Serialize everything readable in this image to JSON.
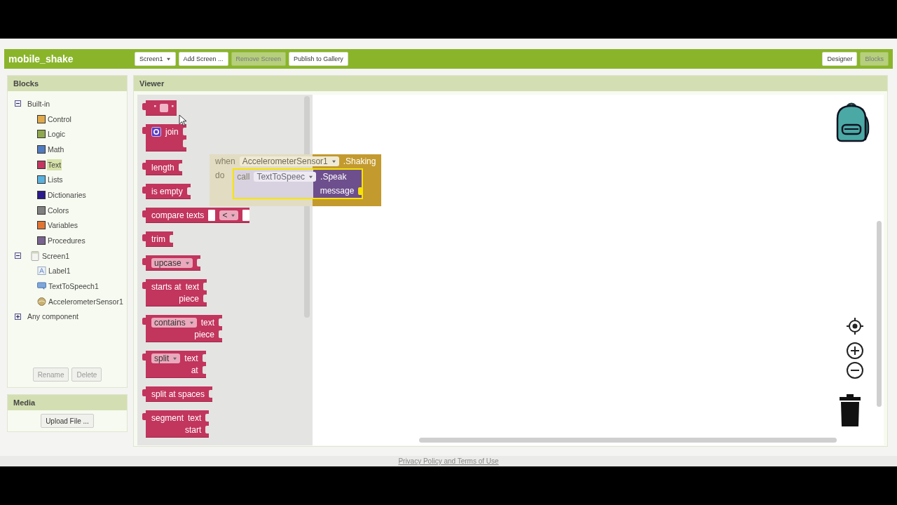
{
  "app": {
    "project_name": "mobile_shake",
    "toolbar_buttons": [
      {
        "label": "Screen1",
        "kind": "dropdown",
        "disabled": false
      },
      {
        "label": "Add Screen ...",
        "kind": "button",
        "disabled": false
      },
      {
        "label": "Remove Screen",
        "kind": "button",
        "disabled": true
      },
      {
        "label": "Publish to Gallery",
        "kind": "button",
        "disabled": false
      }
    ],
    "view_tabs": [
      {
        "label": "Designer",
        "selected": false
      },
      {
        "label": "Blocks",
        "selected": true
      }
    ]
  },
  "blocks_panel": {
    "title": "Blocks",
    "tree": [
      {
        "label": "Built-in",
        "kind": "folder",
        "expanded": true,
        "children": [
          {
            "label": "Control",
            "kind": "category",
            "color": "#e1a94b",
            "selected": false
          },
          {
            "label": "Logic",
            "kind": "category",
            "color": "#8fa84d",
            "selected": false
          },
          {
            "label": "Math",
            "kind": "category",
            "color": "#4f7bc0",
            "selected": false
          },
          {
            "label": "Text",
            "kind": "category",
            "color": "#c4365f",
            "selected": true
          },
          {
            "label": "Lists",
            "kind": "category",
            "color": "#5ab1dd",
            "selected": false
          },
          {
            "label": "Dictionaries",
            "kind": "category",
            "color": "#2a1a8c",
            "selected": false
          },
          {
            "label": "Colors",
            "kind": "category",
            "color": "#808080",
            "selected": false
          },
          {
            "label": "Variables",
            "kind": "category",
            "color": "#e27431",
            "selected": false
          },
          {
            "label": "Procedures",
            "kind": "category",
            "color": "#7a6390",
            "selected": false
          }
        ]
      },
      {
        "label": "Screen1",
        "kind": "screen",
        "expanded": true,
        "children": [
          {
            "label": "Label1",
            "kind": "label",
            "selected": false
          },
          {
            "label": "TextToSpeech1",
            "kind": "speech",
            "selected": false
          },
          {
            "label": "AccelerometerSensor1",
            "kind": "sensor",
            "selected": false
          }
        ]
      },
      {
        "label": "Any component",
        "kind": "folder",
        "expanded": false
      }
    ],
    "buttons": [
      {
        "label": "Rename",
        "disabled": true
      },
      {
        "label": "Delete",
        "disabled": true
      }
    ]
  },
  "media_panel": {
    "title": "Media",
    "button": "Upload File ..."
  },
  "viewer": {
    "title": "Viewer",
    "flyout_blocks": [
      {
        "lines": [
          {
            "items": [
              {
                "kind": "empty-text"
              }
            ]
          }
        ]
      },
      {
        "lines": [
          {
            "items": [
              {
                "kind": "mutator"
              },
              {
                "kind": "label",
                "text": "join"
              },
              {
                "kind": "socket"
              }
            ]
          },
          {
            "items": [
              {
                "kind": "socket"
              }
            ]
          }
        ]
      },
      {
        "lines": [
          {
            "items": [
              {
                "kind": "label",
                "text": "length"
              },
              {
                "kind": "socket"
              }
            ]
          }
        ]
      },
      {
        "lines": [
          {
            "items": [
              {
                "kind": "label",
                "text": "is empty"
              },
              {
                "kind": "socket"
              }
            ]
          }
        ]
      },
      {
        "lines": [
          {
            "items": [
              {
                "kind": "label",
                "text": "compare texts"
              },
              {
                "kind": "inline-socket"
              },
              {
                "kind": "dropdown",
                "text": "<"
              },
              {
                "kind": "inline-socket"
              }
            ]
          }
        ]
      },
      {
        "lines": [
          {
            "items": [
              {
                "kind": "label",
                "text": "trim"
              },
              {
                "kind": "socket"
              }
            ]
          }
        ]
      },
      {
        "lines": [
          {
            "items": [
              {
                "kind": "dropdown",
                "text": "upcase"
              },
              {
                "kind": "socket"
              }
            ]
          }
        ]
      },
      {
        "lines": [
          {
            "items": [
              {
                "kind": "label",
                "text": "starts at"
              },
              {
                "kind": "label",
                "text": "text"
              },
              {
                "kind": "socket"
              }
            ]
          },
          {
            "items": [
              {
                "kind": "label",
                "text": "piece"
              },
              {
                "kind": "socket"
              }
            ]
          }
        ]
      },
      {
        "lines": [
          {
            "items": [
              {
                "kind": "dropdown",
                "text": "contains"
              },
              {
                "kind": "label",
                "text": "text"
              },
              {
                "kind": "socket"
              }
            ]
          },
          {
            "items": [
              {
                "kind": "label",
                "text": "piece"
              },
              {
                "kind": "socket"
              }
            ]
          }
        ]
      },
      {
        "lines": [
          {
            "items": [
              {
                "kind": "dropdown",
                "text": "split"
              },
              {
                "kind": "label",
                "text": "text"
              },
              {
                "kind": "socket"
              }
            ]
          },
          {
            "items": [
              {
                "kind": "label",
                "text": "at"
              },
              {
                "kind": "socket"
              }
            ]
          }
        ]
      },
      {
        "lines": [
          {
            "items": [
              {
                "kind": "label",
                "text": "split at spaces"
              },
              {
                "kind": "socket"
              }
            ]
          }
        ]
      },
      {
        "lines": [
          {
            "items": [
              {
                "kind": "label",
                "text": "segment"
              },
              {
                "kind": "label",
                "text": "text"
              },
              {
                "kind": "socket"
              }
            ]
          },
          {
            "items": [
              {
                "kind": "label",
                "text": "start"
              },
              {
                "kind": "socket"
              }
            ]
          }
        ]
      }
    ],
    "workspace_block": {
      "when": "when",
      "component": "AccelerometerSensor1",
      "event": ".Shaking",
      "do": "do",
      "call": {
        "call": "call",
        "component": "TextToSpeec",
        "method": ".Speak",
        "argument": "message",
        "selected": true
      }
    }
  },
  "footer": {
    "link": "Privacy Policy and Terms of Use"
  }
}
